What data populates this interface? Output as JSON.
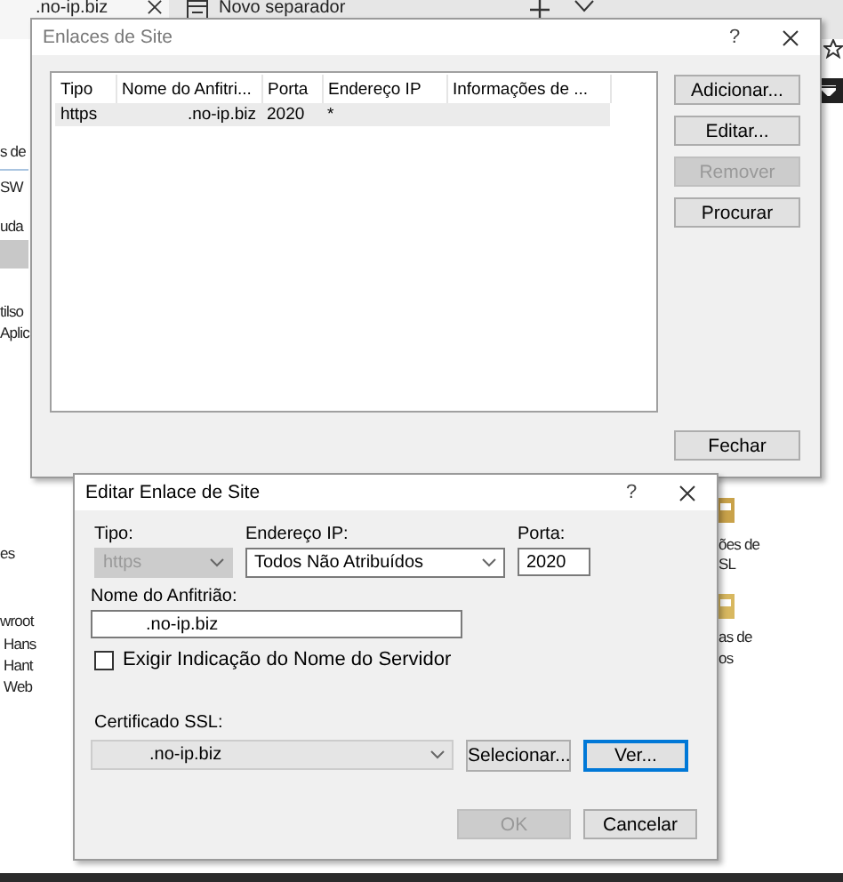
{
  "browser_tabs": [
    {
      "label": ".no-ip.biz",
      "selected": true
    },
    {
      "label": "Novo separador",
      "selected": false
    }
  ],
  "background_left": [
    "s de",
    "SW",
    "uda",
    "tilso",
    "Aplic",
    "es",
    "wroot",
    "Hans",
    "Hant",
    "Web"
  ],
  "background_right": [
    "ões de",
    "SL",
    "as de",
    "os"
  ],
  "site_bindings": {
    "title": "Enlaces de Site",
    "help": "?",
    "columns": [
      "Tipo",
      "Nome do Anfitri...",
      "Porta",
      "Endereço IP",
      "Informações de ..."
    ],
    "rows": [
      {
        "cells": [
          "https",
          ".no-ip.biz",
          "2020",
          "*"
        ],
        "selected": true
      }
    ],
    "buttons": [
      {
        "label": "Adicionar...",
        "disabled": false
      },
      {
        "label": "Editar...",
        "disabled": false
      },
      {
        "label": "Remover",
        "disabled": true
      },
      {
        "label": "Procurar",
        "disabled": false
      }
    ],
    "close_button": "Fechar"
  },
  "edit_binding": {
    "title": "Editar Enlace de Site",
    "help": "?",
    "type": {
      "label": "Tipo:",
      "value": "https",
      "disabled": true
    },
    "ip": {
      "label": "Endereço IP:",
      "value": "Todos Não Atribuídos"
    },
    "port": {
      "label": "Porta:",
      "value": "2020"
    },
    "host": {
      "label": "Nome do Anfitrião:",
      "value": ".no-ip.biz"
    },
    "sni": {
      "label": "Exigir Indicação do Nome do Servidor",
      "checked": false
    },
    "ssl": {
      "label": "Certificado SSL:",
      "value": ".no-ip.biz"
    },
    "cert_buttons": [
      {
        "label": "Selecionar...",
        "focused": false
      },
      {
        "label": "Ver...",
        "focused": true
      }
    ],
    "actions": [
      {
        "label": "OK",
        "disabled": true
      },
      {
        "label": "Cancelar",
        "disabled": false
      }
    ]
  }
}
